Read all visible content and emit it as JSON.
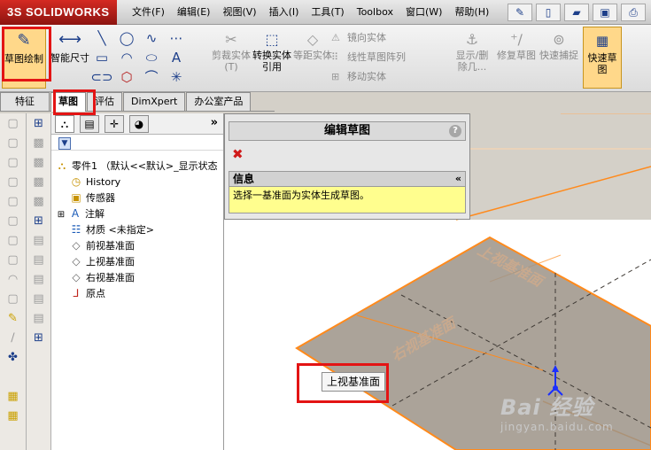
{
  "app": {
    "logo_text": "3S SOLIDWORKS"
  },
  "menu": [
    "文件(F)",
    "编辑(E)",
    "视图(V)",
    "插入(I)",
    "工具(T)",
    "Toolbox",
    "窗口(W)",
    "帮助(H)"
  ],
  "ribbon": {
    "sketch_label": "草图绘制",
    "smart_dim_label": "智能尺寸",
    "trim_label": "剪裁实体(T)",
    "convert_label": "转换实体引用",
    "offset_label": "等距实体",
    "mirror_label": "镜向实体",
    "pattern_label": "线性草图阵列",
    "move_label": "移动实体",
    "show_hide_label": "显示/删除几...",
    "repair_label": "修复草图",
    "quick_snap_label": "快速捕捉",
    "rapid_sketch_label": "快速草图"
  },
  "tabs": [
    "特征",
    "草图",
    "评估",
    "DimXpert",
    "办公室产品"
  ],
  "tree": {
    "more": "»",
    "part": "零件1 （默认<<默认>_显示状态",
    "items": [
      "History",
      "传感器",
      "注解",
      "材质 <未指定>",
      "前视基准面",
      "上视基准面",
      "右视基准面",
      "原点"
    ]
  },
  "property_manager": {
    "title": "编辑草图",
    "help": "?",
    "info_header": "信息",
    "info_collapse": "«",
    "info_text": "选择一基准面为实体生成草图。"
  },
  "scene": {
    "top_plane_label": "上视基准面",
    "right_plane_label": "右视基准面",
    "tooltip": "上视基准面"
  },
  "watermark": {
    "brand": "Bai 经验",
    "url": "jingyan.baidu.com"
  },
  "colors": {
    "highlight": "#e31414",
    "plane_edge": "#ff8a1c",
    "plane_fill": "#9c9387",
    "info_bg": "#fffe8e"
  }
}
